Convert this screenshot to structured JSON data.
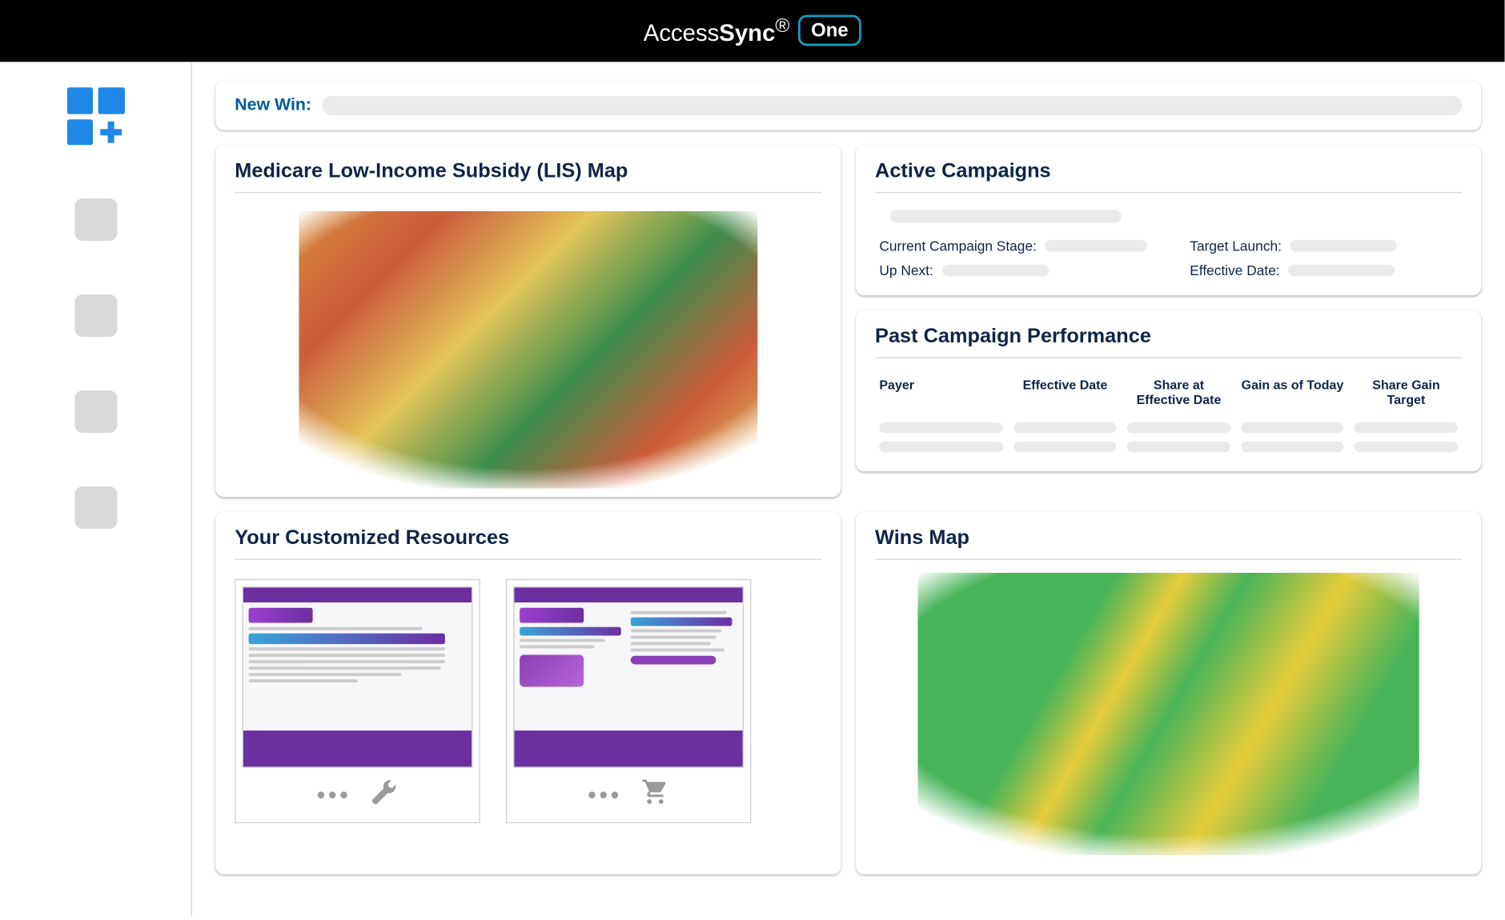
{
  "brand": {
    "name_part1": "Access",
    "name_part2": "Sync",
    "suffix": "One"
  },
  "new_win": {
    "label": "New Win:"
  },
  "cards": {
    "lis_map": {
      "title": "Medicare Low-Income Subsidy (LIS) Map"
    },
    "active_campaigns": {
      "title": "Active Campaigns",
      "fields": {
        "current_stage": "Current Campaign Stage:",
        "up_next": "Up Next:",
        "target_launch": "Target Launch:",
        "effective_date": "Effective Date:"
      }
    },
    "past_performance": {
      "title": "Past Campaign Performance",
      "columns": [
        "Payer",
        "Effective Date",
        "Share at Effective Date",
        "Gain as of Today",
        "Share Gain Target"
      ]
    },
    "resources": {
      "title": "Your Customized Resources",
      "items": [
        {
          "icon": "wrench-icon"
        },
        {
          "icon": "cart-icon"
        }
      ]
    },
    "wins_map": {
      "title": "Wins Map"
    }
  }
}
